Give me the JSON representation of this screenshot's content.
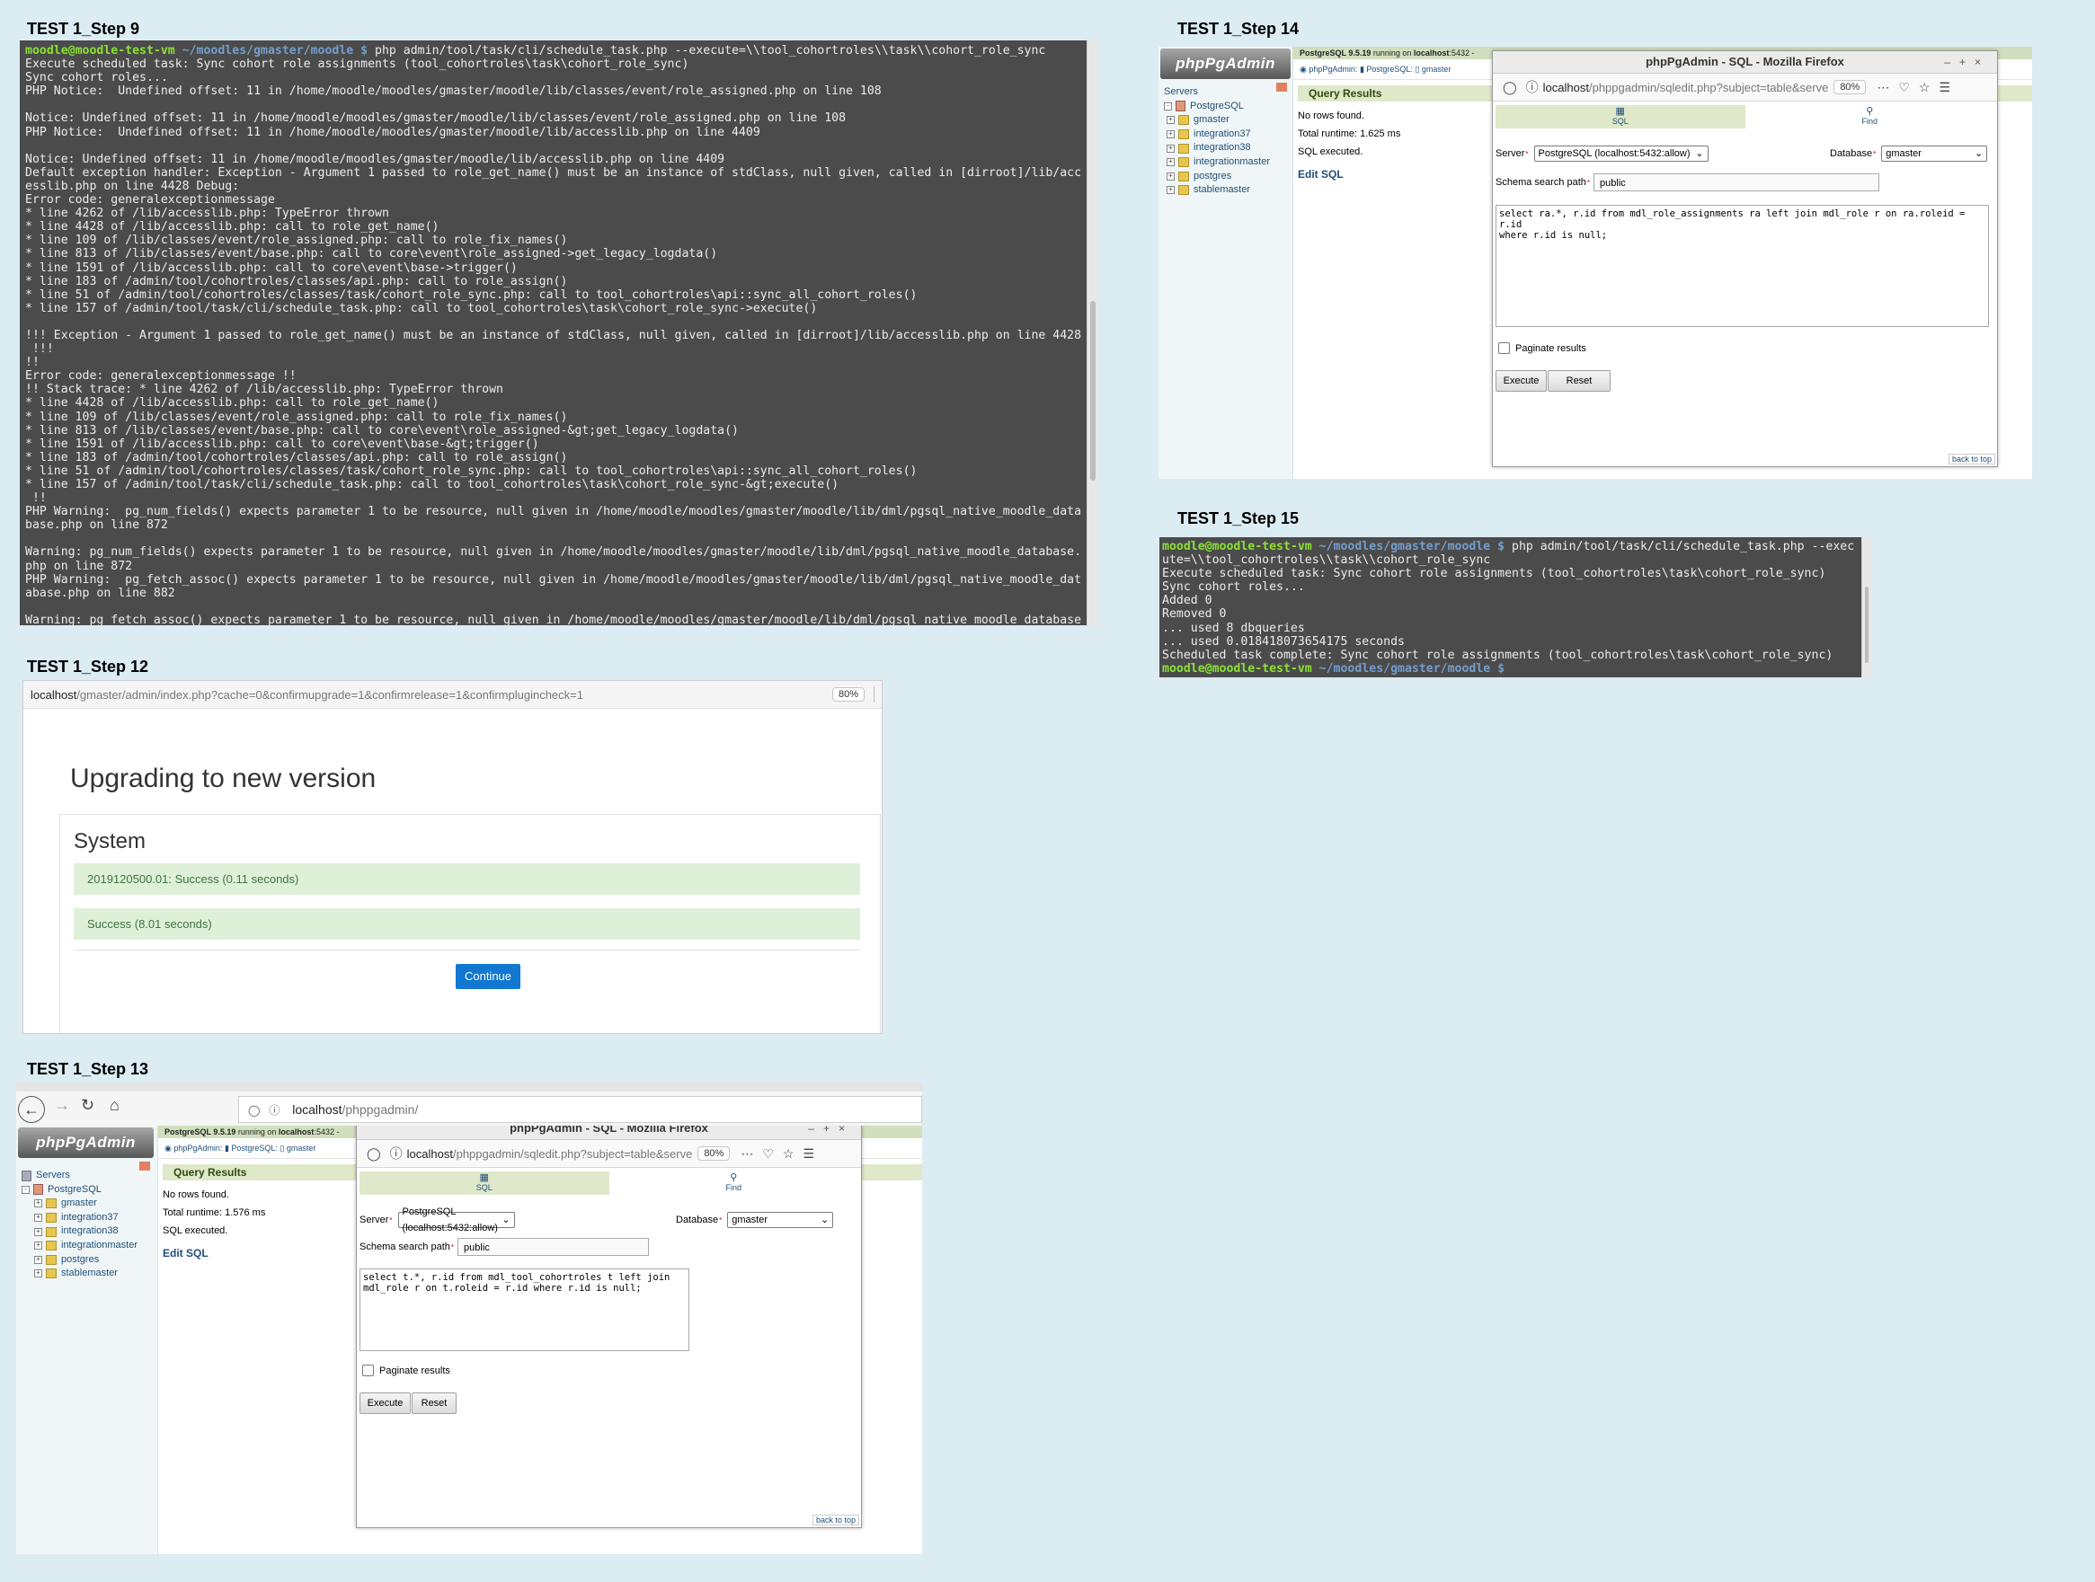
{
  "captions": {
    "step9": "TEST 1_Step 9",
    "step14": "TEST 1_Step 14",
    "step15": "TEST 1_Step 15",
    "step12": "TEST 1_Step 12",
    "step13": "TEST 1_Step 13"
  },
  "step9": {
    "prompt_user": "moodle@moodle-test-vm",
    "prompt_path": " ~/moodles/gmaster/moodle $ ",
    "command": "php admin/tool/task/cli/schedule_task.php --execute=\\\\tool_cohortroles\\\\task\\\\cohort_role_sync",
    "output": [
      "Execute scheduled task: Sync cohort role assignments (tool_cohortroles\\task\\cohort_role_sync)",
      "Sync cohort roles...",
      "PHP Notice:  Undefined offset: 11 in /home/moodle/moodles/gmaster/moodle/lib/classes/event/role_assigned.php on line 108",
      "",
      "Notice: Undefined offset: 11 in /home/moodle/moodles/gmaster/moodle/lib/classes/event/role_assigned.php on line 108",
      "PHP Notice:  Undefined offset: 11 in /home/moodle/moodles/gmaster/moodle/lib/accesslib.php on line 4409",
      "",
      "Notice: Undefined offset: 11 in /home/moodle/moodles/gmaster/moodle/lib/accesslib.php on line 4409",
      "Default exception handler: Exception - Argument 1 passed to role_get_name() must be an instance of stdClass, null given, called in [dirroot]/lib/acc",
      "esslib.php on line 4428 Debug:",
      "Error code: generalexceptionmessage",
      "* line 4262 of /lib/accesslib.php: TypeError thrown",
      "* line 4428 of /lib/accesslib.php: call to role_get_name()",
      "* line 109 of /lib/classes/event/role_assigned.php: call to role_fix_names()",
      "* line 813 of /lib/classes/event/base.php: call to core\\event\\role_assigned->get_legacy_logdata()",
      "* line 1591 of /lib/accesslib.php: call to core\\event\\base->trigger()",
      "* line 183 of /admin/tool/cohortroles/classes/api.php: call to role_assign()",
      "* line 51 of /admin/tool/cohortroles/classes/task/cohort_role_sync.php: call to tool_cohortroles\\api::sync_all_cohort_roles()",
      "* line 157 of /admin/tool/task/cli/schedule_task.php: call to tool_cohortroles\\task\\cohort_role_sync->execute()",
      "",
      "!!! Exception - Argument 1 passed to role_get_name() must be an instance of stdClass, null given, called in [dirroot]/lib/accesslib.php on line 4428",
      " !!!",
      "!!",
      "Error code: generalexceptionmessage !!",
      "!! Stack trace: * line 4262 of /lib/accesslib.php: TypeError thrown",
      "* line 4428 of /lib/accesslib.php: call to role_get_name()",
      "* line 109 of /lib/classes/event/role_assigned.php: call to role_fix_names()",
      "* line 813 of /lib/classes/event/base.php: call to core\\event\\role_assigned-&gt;get_legacy_logdata()",
      "* line 1591 of /lib/accesslib.php: call to core\\event\\base-&gt;trigger()",
      "* line 183 of /admin/tool/cohortroles/classes/api.php: call to role_assign()",
      "* line 51 of /admin/tool/cohortroles/classes/task/cohort_role_sync.php: call to tool_cohortroles\\api::sync_all_cohort_roles()",
      "* line 157 of /admin/tool/task/cli/schedule_task.php: call to tool_cohortroles\\task\\cohort_role_sync-&gt;execute()",
      " !!",
      "PHP Warning:  pg_num_fields() expects parameter 1 to be resource, null given in /home/moodle/moodles/gmaster/moodle/lib/dml/pgsql_native_moodle_data",
      "base.php on line 872",
      "",
      "Warning: pg_num_fields() expects parameter 1 to be resource, null given in /home/moodle/moodles/gmaster/moodle/lib/dml/pgsql_native_moodle_database.",
      "php on line 872",
      "PHP Warning:  pg_fetch_assoc() expects parameter 1 to be resource, null given in /home/moodle/moodles/gmaster/moodle/lib/dml/pgsql_native_moodle_dat",
      "abase.php on line 882",
      "",
      "Warning: pg_fetch_assoc() expects parameter 1 to be resource, null given in /home/moodle/moodles/gmaster/moodle/lib/dml/pgsql_native_moodle_database"
    ]
  },
  "step15": {
    "prompt_user": "moodle@moodle-test-vm",
    "prompt_path": " ~/moodles/gmaster/moodle $ ",
    "command": "php admin/tool/task/cli/schedule_task.php --exec",
    "output": [
      "ute=\\\\tool_cohortroles\\\\task\\\\cohort_role_sync",
      "Execute scheduled task: Sync cohort role assignments (tool_cohortroles\\task\\cohort_role_sync)",
      "Sync cohort roles...",
      "Added 0",
      "Removed 0",
      "... used 8 dbqueries",
      "... used 0.018418073654175 seconds",
      "Scheduled task complete: Sync cohort role assignments (tool_cohortroles\\task\\cohort_role_sync)"
    ],
    "final_prompt_user": "moodle@moodle-test-vm",
    "final_prompt_path": " ~/moodles/gmaster/moodle $"
  },
  "step12": {
    "url_host": "localhost",
    "url_path": "/gmaster/admin/index.php?cache=0&confirmupgrade=1&confirmrelease=1&confirmplugincheck=1",
    "zoom": "80%",
    "heading": "Upgrading to new version",
    "section": "System",
    "rows": [
      "2019120500.01: Success (0.11 seconds)",
      "Success (8.01 seconds)"
    ],
    "continue_label": "Continue"
  },
  "step13": {
    "browser_url_host": "localhost",
    "browser_url_path": "/phppgadmin/",
    "logo": "phpPgAdmin",
    "top_info_pre": "PostgreSQL 9.5.19",
    "top_info_mid": " running on ",
    "top_info_host": "localhost",
    "top_info_post": ":5432 -",
    "crumb1": "phpPgAdmin",
    "crumb2": "PostgreSQL",
    "crumb3": "gmaster",
    "tree_root": "Servers",
    "tree_server": "PostgreSQL",
    "tree_dbs": [
      "gmaster",
      "integration37",
      "integration38",
      "integrationmaster",
      "postgres",
      "stablemaster"
    ],
    "query_results": "Query Results",
    "no_rows": "No rows found.",
    "runtime": "Total runtime: 1.576 ms",
    "executed": "SQL executed.",
    "edit_sql": "Edit SQL",
    "popup_title": "phpPgAdmin - SQL - Mozilla Firefox",
    "popup_url_host": "localhost",
    "popup_url_path": "/phppgadmin/sqledit.php?subject=table&serve",
    "zoom": "80%",
    "tab_sql": "SQL",
    "tab_find": "Find",
    "server_label": "Server",
    "server_value": "PostgreSQL (localhost:5432:allow)",
    "database_label": "Database",
    "database_value": "gmaster",
    "schema_label": "Schema search path",
    "schema_value": "public",
    "sql": "select t.*, r.id from mdl_tool_cohortroles t left join mdl_role r on t.roleid = r.id where r.id is null;",
    "paginate": "Paginate results",
    "execute": "Execute",
    "reset": "Reset",
    "back_to_top": "back to top"
  },
  "step14": {
    "logo": "phpPgAdmin",
    "top_info_pre": "PostgreSQL 9.5.19",
    "top_info_mid": " running on ",
    "top_info_host": "localhost",
    "top_info_post": ":5432 -",
    "crumb1": "phpPgAdmin",
    "crumb2": "PostgreSQL",
    "crumb3": "gmaster",
    "tree_root": "Servers",
    "tree_server": "PostgreSQL",
    "tree_dbs": [
      "gmaster",
      "integration37",
      "integration38",
      "integrationmaster",
      "postgres",
      "stablemaster"
    ],
    "query_results": "Query Results",
    "no_rows": "No rows found.",
    "runtime": "Total runtime: 1.625 ms",
    "executed": "SQL executed.",
    "edit_sql": "Edit SQL",
    "popup_title": "phpPgAdmin - SQL - Mozilla Firefox",
    "popup_url_host": "localhost",
    "popup_url_path": "/phppgadmin/sqledit.php?subject=table&serve",
    "zoom": "80%",
    "tab_sql": "SQL",
    "tab_find": "Find",
    "server_label": "Server",
    "server_value": "PostgreSQL (localhost:5432:allow)",
    "database_label": "Database",
    "database_value": "gmaster",
    "schema_label": "Schema search path",
    "schema_value": "public",
    "sql": "select ra.*, r.id from mdl_role_assignments ra left join mdl_role r on ra.roleid = r.id\nwhere r.id is null;",
    "paginate": "Paginate results",
    "execute": "Execute",
    "reset": "Reset",
    "back_to_top": "back to top"
  }
}
